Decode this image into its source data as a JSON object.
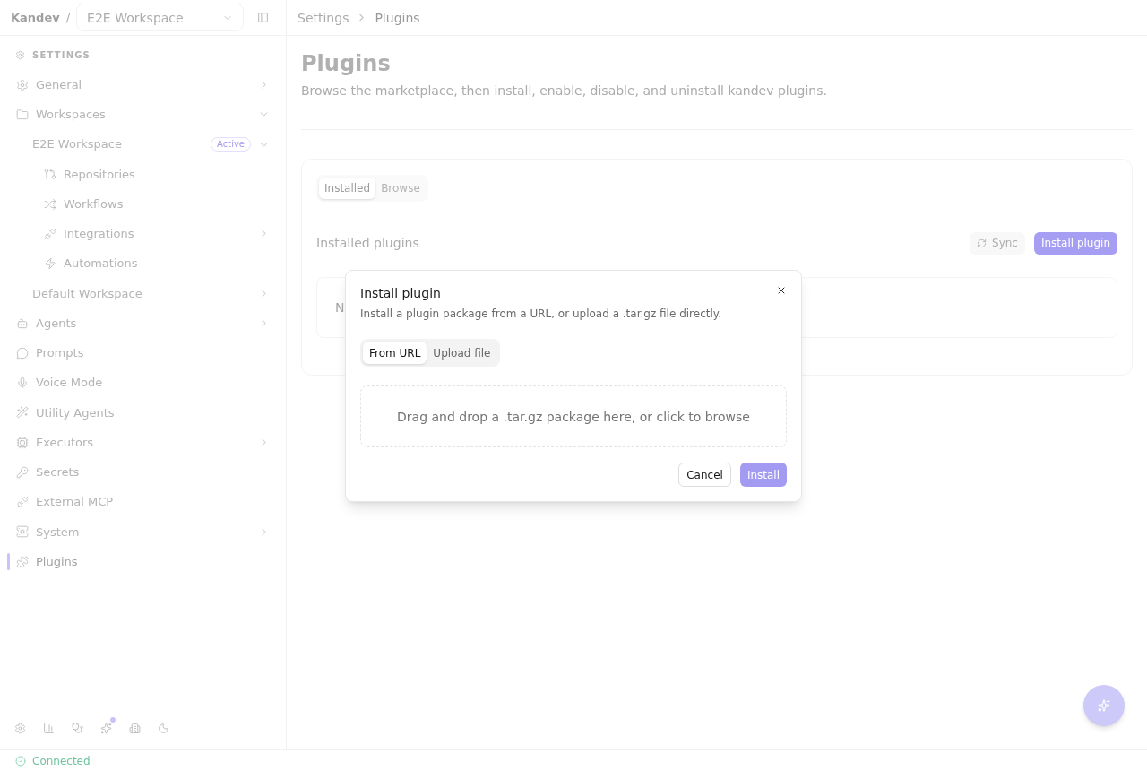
{
  "sidebar": {
    "brand": "Kandev",
    "separator": "/",
    "workspace_select": {
      "value": "E2E Workspace"
    },
    "section_title": "SETTINGS",
    "items": [
      {
        "label": "General",
        "selected": false,
        "expanded": false
      },
      {
        "label": "Workspaces",
        "selected": false,
        "expanded": true,
        "children": [
          {
            "label": "E2E Workspace",
            "badge": "Active",
            "selected": false,
            "expanded": true,
            "children": [
              {
                "label": "Repositories",
                "selected": false
              },
              {
                "label": "Workflows",
                "selected": false
              },
              {
                "label": "Integrations",
                "selected": false,
                "expanded": false
              },
              {
                "label": "Automations",
                "selected": false
              }
            ]
          },
          {
            "label": "Default Workspace",
            "selected": false,
            "expanded": false
          }
        ]
      },
      {
        "label": "Agents",
        "selected": false,
        "expanded": false
      },
      {
        "label": "Prompts",
        "selected": false
      },
      {
        "label": "Voice Mode",
        "selected": false
      },
      {
        "label": "Utility Agents",
        "selected": false
      },
      {
        "label": "Executors",
        "selected": false,
        "expanded": false
      },
      {
        "label": "Secrets",
        "selected": false
      },
      {
        "label": "External MCP",
        "selected": false
      },
      {
        "label": "System",
        "selected": false,
        "expanded": false
      },
      {
        "label": "Plugins",
        "selected": true
      }
    ],
    "toolbar": [
      {
        "dot": false
      },
      {
        "dot": false
      },
      {
        "dot": false
      },
      {
        "dot": true
      },
      {
        "dot": false
      },
      {
        "dot": false
      }
    ]
  },
  "breadcrumb": [
    "Settings",
    "Plugins"
  ],
  "page": {
    "title": "Plugins",
    "subtitle": "Browse the marketplace, then install, enable, disable, and uninstall kandev plugins."
  },
  "plugins_card": {
    "tabs": [
      {
        "label": "Installed",
        "selected": true
      },
      {
        "label": "Browse",
        "selected": false
      }
    ],
    "section_title": "Installed plugins",
    "sync_button": "Sync",
    "install_button": "Install plugin",
    "empty_state": "N"
  },
  "dialog": {
    "title": "Install plugin",
    "description": "Install a plugin package from a URL, or upload a .tar.gz file directly.",
    "tabs": [
      {
        "label": "From URL",
        "selected": true
      },
      {
        "label": "Upload file",
        "selected": false
      }
    ],
    "dropzone": "Drag and drop a .tar.gz package here, or click to browse",
    "buttons": [
      {
        "label": "Cancel",
        "kind": "secondary",
        "disabled": false
      },
      {
        "label": "Install",
        "kind": "primary",
        "disabled": true
      }
    ]
  },
  "status_bar": {
    "text": "Connected"
  }
}
